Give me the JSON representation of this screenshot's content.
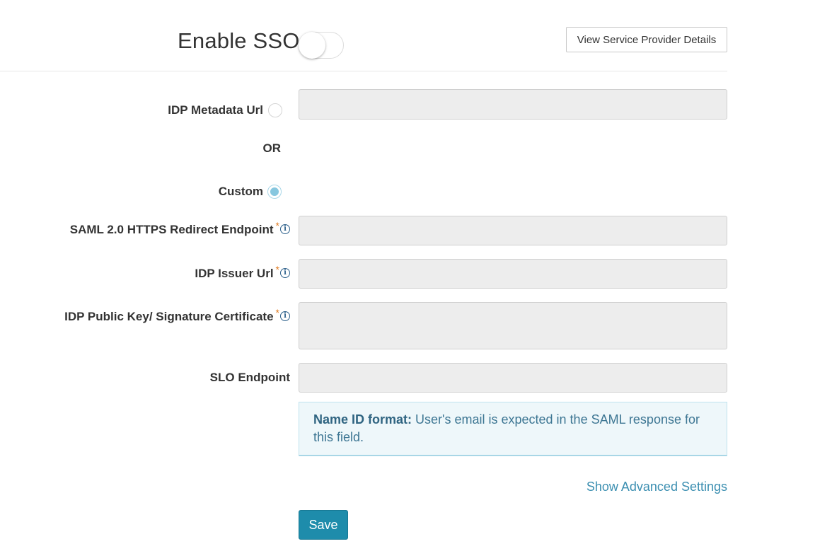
{
  "header": {
    "title": "Enable SSO",
    "toggle_enabled": false,
    "view_sp_button": "View Service Provider Details"
  },
  "form": {
    "metadata_url": {
      "label": "IDP Metadata Url",
      "selected": false,
      "value": ""
    },
    "or_text": "OR",
    "custom": {
      "label": "Custom",
      "selected": true
    },
    "saml_endpoint": {
      "label": "SAML 2.0 HTTPS Redirect Endpoint",
      "required": "*",
      "info": "i",
      "value": ""
    },
    "issuer_url": {
      "label": "IDP Issuer Url",
      "required": "*",
      "info": "i",
      "value": ""
    },
    "public_key": {
      "label": "IDP Public Key/ Signature Certificate",
      "required": "*",
      "info": "i",
      "value": ""
    },
    "slo_endpoint": {
      "label": "SLO Endpoint",
      "value": ""
    }
  },
  "notice": {
    "title": "Name ID format:",
    "text": " User's email is expected in the SAML response for this field."
  },
  "advanced_link": "Show Advanced Settings",
  "save_button": "Save",
  "colors": {
    "accent": "#1e8cab",
    "link": "#3c8fb1",
    "required": "#e07b22",
    "notice_bg": "#eef7fa"
  }
}
